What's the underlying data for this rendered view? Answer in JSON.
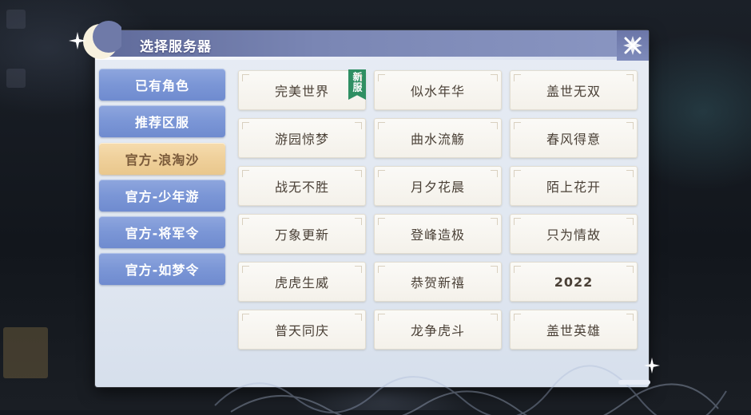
{
  "dialog": {
    "title": "选择服务器"
  },
  "tabs": [
    {
      "label": "已有角色",
      "active": false
    },
    {
      "label": "推荐区服",
      "active": false
    },
    {
      "label": "官方-浪淘沙",
      "active": true
    },
    {
      "label": "官方-少年游",
      "active": false
    },
    {
      "label": "官方-将军令",
      "active": false
    },
    {
      "label": "官方-如梦令",
      "active": false
    }
  ],
  "servers": [
    {
      "name": "完美世界",
      "badge": "新服"
    },
    {
      "name": "似水年华"
    },
    {
      "name": "盖世无双"
    },
    {
      "name": "游园惊梦"
    },
    {
      "name": "曲水流觞"
    },
    {
      "name": "春风得意"
    },
    {
      "name": "战无不胜"
    },
    {
      "name": "月夕花晨"
    },
    {
      "name": "陌上花开"
    },
    {
      "name": "万象更新"
    },
    {
      "name": "登峰造极"
    },
    {
      "name": "只为情故"
    },
    {
      "name": "虎虎生威"
    },
    {
      "name": "恭贺新禧"
    },
    {
      "name": "2022"
    },
    {
      "name": "普天同庆"
    },
    {
      "name": "龙争虎斗"
    },
    {
      "name": "盖世英雄"
    }
  ],
  "icons": {
    "close": "close-icon",
    "moon": "crescent-moon-icon",
    "sparkle": "sparkle-icon"
  },
  "colors": {
    "tab_blue": "#7b96d6",
    "tab_active": "#efd09b",
    "badge_green": "#2f8f63",
    "title_bar": "#7a86b4"
  }
}
